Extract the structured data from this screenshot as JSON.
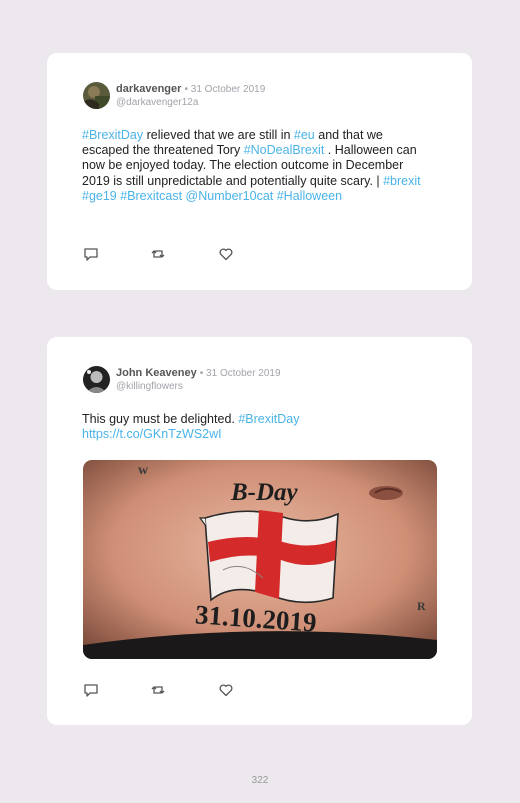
{
  "tweets": [
    {
      "display_name": "darkavenger",
      "date": "• 31 October 2019",
      "handle": "@darkavenger12a",
      "text": [
        {
          "t": "#BrexitDay",
          "tag": true
        },
        {
          "t": " relieved that we are still in ",
          "tag": false
        },
        {
          "t": "#eu",
          "tag": true
        },
        {
          "t": " and that we escaped the threatened Tory ",
          "tag": false
        },
        {
          "t": "#NoDealBrexit",
          "tag": true
        },
        {
          "t": " . Halloween can now be enjoyed today. The election outcome in December 2019 is still unpredictable and potentially quite scary. | ",
          "tag": false
        },
        {
          "t": "#brexit #ge19 #Brexitcast @Number10cat #Halloween",
          "tag": true
        }
      ]
    },
    {
      "display_name": "John Keaveney",
      "date": "• 31 October 2019",
      "handle": "@killingflowers",
      "text": [
        {
          "t": "This guy must be delighted. ",
          "tag": false
        },
        {
          "t": "#BrexitDay",
          "tag": true
        },
        {
          "t": " https://t.co/GKnTzWS2wI",
          "tag": true
        }
      ],
      "image": {
        "tattoo_top": "B-Day",
        "tattoo_bottom": "31.10.2019"
      }
    }
  ],
  "icons": [
    "reply-icon",
    "retweet-icon",
    "like-icon"
  ],
  "colors": {
    "link": "#4ab3e8",
    "flag_red": "#d42a2a"
  },
  "page_number": "322"
}
